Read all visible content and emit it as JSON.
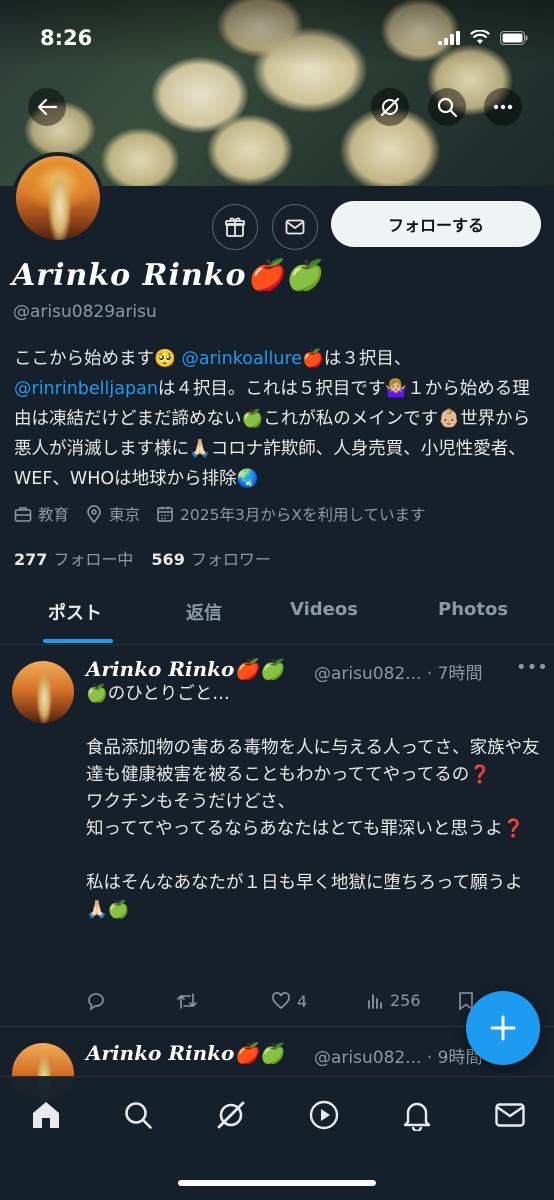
{
  "status_bar": {
    "time": "8:26"
  },
  "profile": {
    "follow_label": "フォローする",
    "display_name": "𝑨𝒓𝒊𝒏𝒌𝒐 𝑹𝒊𝒏𝒌𝒐🍎🍏",
    "handle": "@arisu0829arisu",
    "bio": {
      "l1_a": "ここから始めます🥺 ",
      "mention1": "@arinkoallure",
      "l1_b": "🍎は３択目、",
      "mention2": "@rinrinbelljapan",
      "l2_b": "は４択目。これは５択目です🤷🏼‍♀️１から始める理由は凍結だけどまだ諦めない🍏これが私のメインです👶🏼世界から悪人が消滅します様に🙏🏻コロナ詐欺師、人身売買、小児性愛者、WEF、WHOは地球から排除🌏"
    },
    "meta": {
      "category": "教育",
      "location": "東京",
      "joined": "2025年3月からXを利用しています"
    },
    "following_count": "277",
    "following_label": "フォロー中",
    "followers_count": "569",
    "followers_label": "フォロワー"
  },
  "tabs": [
    "ポスト",
    "返信",
    "Videos",
    "Photos"
  ],
  "posts": [
    {
      "name": "𝑨𝒓𝒊𝒏𝒌𝒐 𝑹𝒊𝒏𝒌𝒐🍎🍏",
      "handle_time": "@arisu082... · 7時間",
      "lines": [
        "🍏のひとりごと…",
        "",
        "食品添加物の害ある毒物を人に与える人ってさ、家族や友達も健康被害を被ることもわかっててやってるの❓",
        "ワクチンもそうだけどさ、",
        "知っててやってるならあなたはとても罪深いと思うよ❓",
        "",
        "私はそんなあなたが１日も早く地獄に堕ちろって願うよ🙏🏻🍏"
      ],
      "likes": "4",
      "views": "256"
    },
    {
      "name": "𝑨𝒓𝒊𝒏𝒌𝒐 𝑹𝒊𝒏𝒌𝒐🍎🍏",
      "handle_time": "@arisu082... · 9時間"
    }
  ],
  "colors": {
    "accent": "#1d9bf0",
    "background": "#15202b",
    "text": "#e7e9ea",
    "muted": "#8b98a5"
  }
}
